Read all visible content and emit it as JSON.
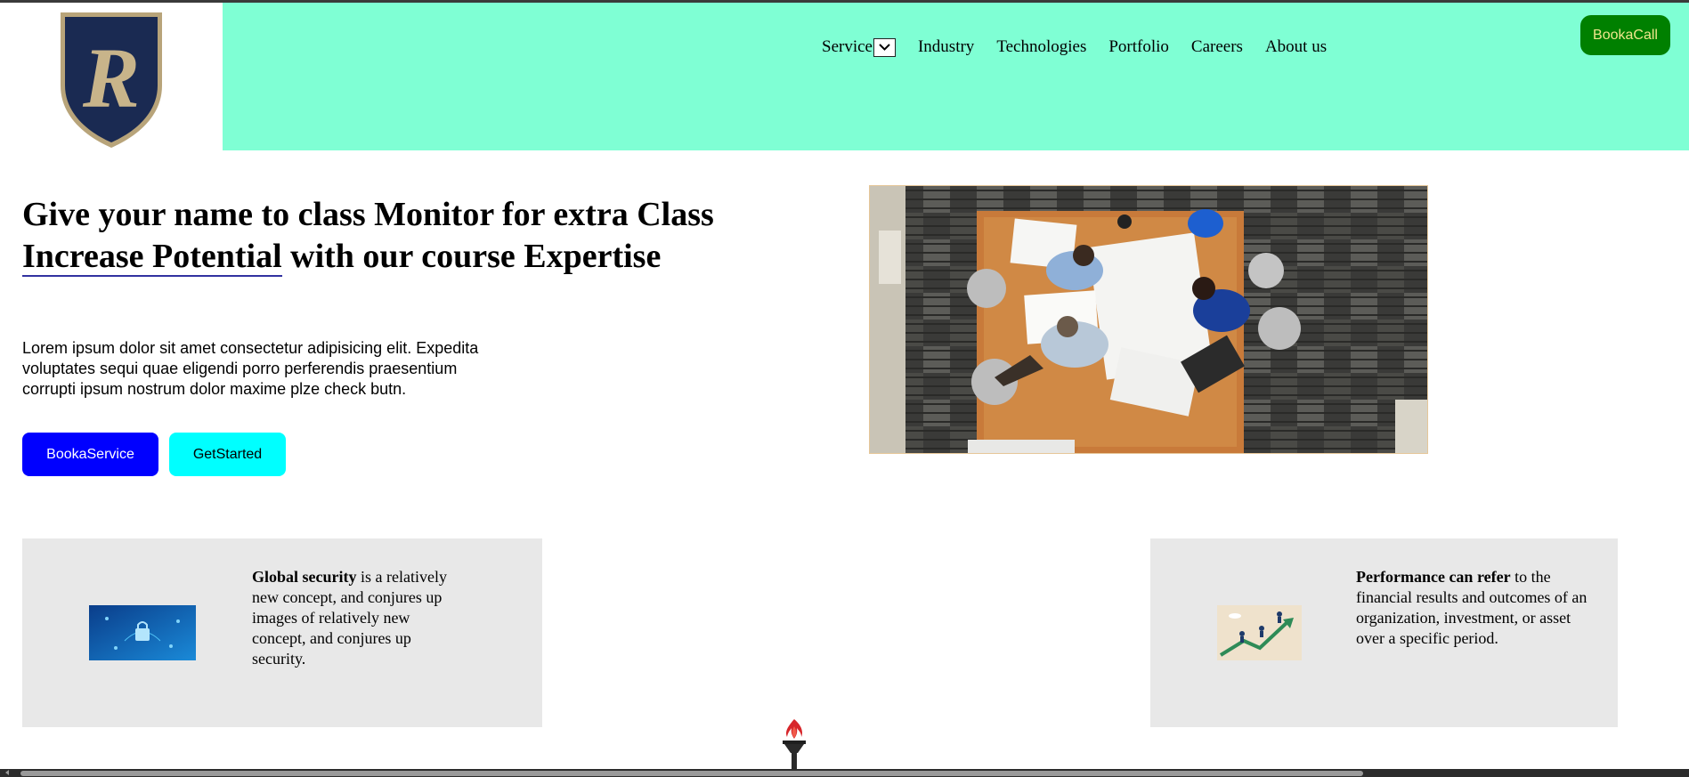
{
  "header": {
    "logo_icon": "shield-R-crest",
    "nav": {
      "service_label": "Service",
      "service_dropdown_icon": "chevron-down-icon",
      "items": [
        "Industry",
        "Technologies",
        "Portfolio",
        "Careers",
        "About us"
      ]
    },
    "cta_label": "BookaCall",
    "colors": {
      "nav_background": "#7fffd4",
      "cta_background": "#008000",
      "cta_text": "#f0e68c"
    }
  },
  "hero": {
    "title_part1": "Give your name to class Monitor for extra Class ",
    "title_highlight": "Increase Potential",
    "title_part2": " with our course Expertise",
    "description": "Lorem ipsum dolor sit amet consectetur adipisicing elit. Expedita voluptates sequi quae eligendi porro perferendis praesentium corrupti ipsum nostrum dolor maxime plze check butn.",
    "buttons": {
      "book_service": "BookaService",
      "get_started": "GetStarted"
    },
    "colors": {
      "book_service": "#0000ff",
      "get_started": "#00ffff"
    }
  },
  "cards": [
    {
      "bold": "Global security",
      "text": " is a relatively new concept, and conjures up images of relatively new concept, and conjures up security."
    },
    {
      "bold": "Performance can refer",
      "text": " to the financial results and outcomes of an organization, investment, or asset over a specific period."
    }
  ]
}
